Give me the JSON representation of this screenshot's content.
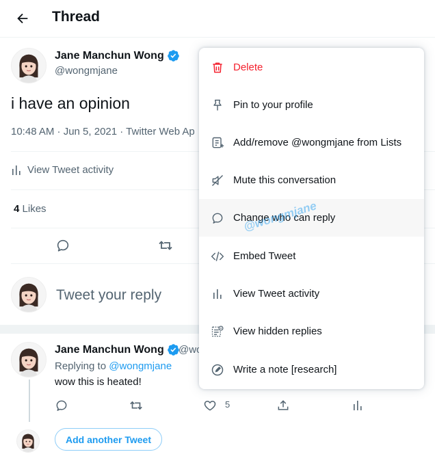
{
  "header": {
    "title": "Thread",
    "back_icon": "arrow-left-icon"
  },
  "main_tweet": {
    "author_name": "Jane Manchun Wong",
    "handle": "@wongmjane",
    "text": "i have an opinion",
    "meta": "10:48 AM · Jun 5, 2021 · Twitter Web Ap",
    "activity_label": "View Tweet activity",
    "likes_count": "4",
    "likes_label": "Likes"
  },
  "reply_composer": {
    "placeholder": "Tweet your reply"
  },
  "reply_tweet": {
    "author_name": "Jane Manchun Wong",
    "handle": "@wo",
    "replying_prefix": "Replying to",
    "replying_to": "@wongmjane",
    "text": "wow this is heated!",
    "like_count": "5",
    "add_another_label": "Add another Tweet"
  },
  "menu": {
    "items": [
      {
        "label": "Delete",
        "icon": "trash-icon"
      },
      {
        "label": "Pin to your profile",
        "icon": "pin-icon"
      },
      {
        "label": "Add/remove @wongmjane from Lists",
        "icon": "list-icon"
      },
      {
        "label": "Mute this conversation",
        "icon": "mute-icon"
      },
      {
        "label": "Change who can reply",
        "icon": "speech-bubble-icon"
      },
      {
        "label": "Embed Tweet",
        "icon": "code-icon"
      },
      {
        "label": "View Tweet activity",
        "icon": "bar-chart-icon"
      },
      {
        "label": "View hidden replies",
        "icon": "hidden-replies-icon"
      },
      {
        "label": "Write a note [research]",
        "icon": "note-icon"
      }
    ]
  },
  "watermark": "@wongmjane",
  "colors": {
    "accent": "#1d9bf0",
    "danger": "#f4212e",
    "text": "#0f1419",
    "muted": "#536471"
  }
}
